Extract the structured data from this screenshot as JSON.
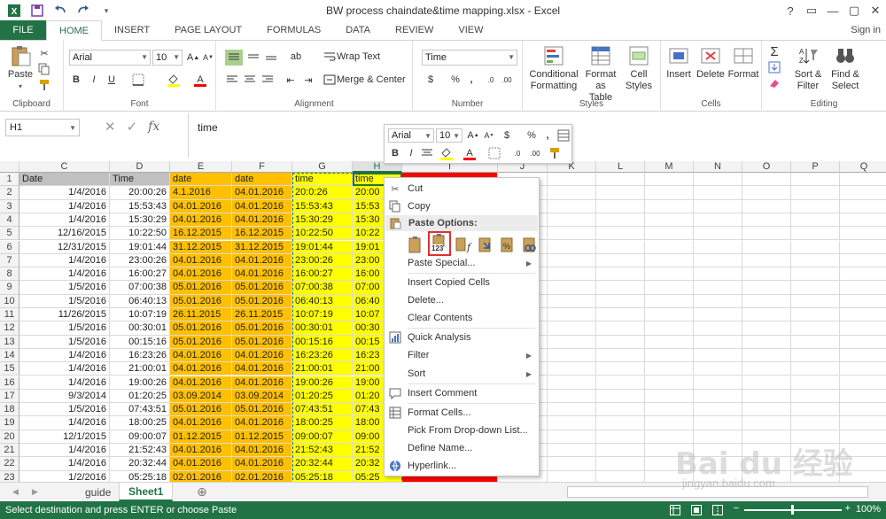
{
  "window": {
    "title": "BW process chaindate&time mapping.xlsx - Excel",
    "controls": [
      "?",
      "▭",
      "—",
      "▢",
      "✕"
    ],
    "signin": "Sign in"
  },
  "ribbon_tabs": [
    "FILE",
    "HOME",
    "INSERT",
    "PAGE LAYOUT",
    "FORMULAS",
    "DATA",
    "REVIEW",
    "VIEW"
  ],
  "ribbon": {
    "clipboard": {
      "paste": "Paste",
      "label": "Clipboard"
    },
    "font": {
      "name": "Arial",
      "size": "10",
      "bold": "B",
      "italic": "I",
      "underline": "U",
      "label": "Font"
    },
    "alignment": {
      "wrap": "Wrap Text",
      "merge": "Merge & Center",
      "label": "Alignment"
    },
    "number": {
      "format": "Time",
      "currency": "$",
      "percent": "%",
      "comma": ",",
      "label": "Number"
    },
    "styles": {
      "conditional": "Conditional\nFormatting",
      "format_table": "Format as\nTable",
      "cell_styles": "Cell\nStyles",
      "label": "Styles"
    },
    "cells": {
      "insert": "Insert",
      "delete": "Delete",
      "format": "Format",
      "label": "Cells"
    },
    "editing": {
      "sort": "Sort &\nFilter",
      "find": "Find &\nSelect",
      "label": "Editing"
    }
  },
  "formula_bar": {
    "name_box": "H1",
    "fx": "fx",
    "content": "time"
  },
  "columns": [
    {
      "letter": "C",
      "w": 102
    },
    {
      "letter": "D",
      "w": 68
    },
    {
      "letter": "E",
      "w": 70
    },
    {
      "letter": "F",
      "w": 68
    },
    {
      "letter": "G",
      "w": 68
    },
    {
      "letter": "H",
      "w": 56
    },
    {
      "letter": "I",
      "w": 108
    },
    {
      "letter": "J",
      "w": 56
    },
    {
      "letter": "K",
      "w": 55
    },
    {
      "letter": "L",
      "w": 55
    },
    {
      "letter": "M",
      "w": 55
    },
    {
      "letter": "N",
      "w": 55
    },
    {
      "letter": "O",
      "w": 55
    },
    {
      "letter": "P",
      "w": 55
    },
    {
      "letter": "Q",
      "w": 55
    }
  ],
  "rows": [
    {
      "n": "1",
      "c": [
        "Date",
        "Time",
        "date",
        "date",
        "time",
        "time",
        "",
        ""
      ]
    },
    {
      "n": "2",
      "c": [
        "1/4/2016",
        "20:00:26",
        "4.1.2016",
        "04.01.2016",
        "20:0:26",
        "20:00",
        "",
        ""
      ]
    },
    {
      "n": "3",
      "c": [
        "1/4/2016",
        "15:53:43",
        "04.01.2016",
        "04.01.2016",
        "15:53:43",
        "15:53",
        "",
        ""
      ]
    },
    {
      "n": "4",
      "c": [
        "1/4/2016",
        "15:30:29",
        "04.01.2016",
        "04.01.2016",
        "15:30:29",
        "15:30",
        "",
        ""
      ]
    },
    {
      "n": "5",
      "c": [
        "12/16/2015",
        "10:22:50",
        "16.12.2015",
        "16.12.2015",
        "10:22:50",
        "10:22",
        "",
        ""
      ]
    },
    {
      "n": "6",
      "c": [
        "12/31/2015",
        "19:01:44",
        "31.12.2015",
        "31.12.2015",
        "19:01:44",
        "19:01",
        "",
        ""
      ]
    },
    {
      "n": "7",
      "c": [
        "1/4/2016",
        "23:00:26",
        "04.01.2016",
        "04.01.2016",
        "23:00:26",
        "23:00",
        "",
        ""
      ]
    },
    {
      "n": "8",
      "c": [
        "1/4/2016",
        "16:00:27",
        "04.01.2016",
        "04.01.2016",
        "16:00:27",
        "16:00",
        "",
        ""
      ]
    },
    {
      "n": "9",
      "c": [
        "1/5/2016",
        "07:00:38",
        "05.01.2016",
        "05.01.2016",
        "07:00:38",
        "07:00",
        "",
        ""
      ]
    },
    {
      "n": "10",
      "c": [
        "1/5/2016",
        "06:40:13",
        "05.01.2016",
        "05.01.2016",
        "06:40:13",
        "06:40",
        "",
        ""
      ]
    },
    {
      "n": "11",
      "c": [
        "11/26/2015",
        "10:07:19",
        "26.11.2015",
        "26.11.2015",
        "10:07:19",
        "10:07",
        "",
        ""
      ]
    },
    {
      "n": "12",
      "c": [
        "1/5/2016",
        "00:30:01",
        "05.01.2016",
        "05.01.2016",
        "00:30:01",
        "00:30",
        "",
        ""
      ]
    },
    {
      "n": "13",
      "c": [
        "1/5/2016",
        "00:15:16",
        "05.01.2016",
        "05.01.2016",
        "00:15:16",
        "00:15",
        "",
        ""
      ]
    },
    {
      "n": "14",
      "c": [
        "1/4/2016",
        "16:23:26",
        "04.01.2016",
        "04.01.2016",
        "16:23:26",
        "16:23",
        "",
        ""
      ]
    },
    {
      "n": "15",
      "c": [
        "1/4/2016",
        "21:00:01",
        "04.01.2016",
        "04.01.2016",
        "21:00:01",
        "21:00",
        "",
        ""
      ]
    },
    {
      "n": "16",
      "c": [
        "1/4/2016",
        "19:00:26",
        "04.01.2016",
        "04.01.2016",
        "19:00:26",
        "19:00",
        "",
        ""
      ]
    },
    {
      "n": "17",
      "c": [
        "9/3/2014",
        "01:20:25",
        "03.09.2014",
        "03.09.2014",
        "01:20:25",
        "01:20",
        "",
        ""
      ]
    },
    {
      "n": "18",
      "c": [
        "1/5/2016",
        "07:43:51",
        "05.01.2016",
        "05.01.2016",
        "07:43:51",
        "07:43",
        "",
        ""
      ]
    },
    {
      "n": "19",
      "c": [
        "1/4/2016",
        "18:00:25",
        "04.01.2016",
        "04.01.2016",
        "18:00:25",
        "18:00",
        "",
        ""
      ]
    },
    {
      "n": "20",
      "c": [
        "12/1/2015",
        "09:00:07",
        "01.12.2015",
        "01.12.2015",
        "09:00:07",
        "09:00",
        "",
        ""
      ]
    },
    {
      "n": "21",
      "c": [
        "1/4/2016",
        "21:52:43",
        "04.01.2016",
        "04.01.2016",
        "21:52:43",
        "21:52",
        "",
        ""
      ]
    },
    {
      "n": "22",
      "c": [
        "1/4/2016",
        "20:32:44",
        "04.01.2016",
        "04.01.2016",
        "20:32:44",
        "20:32",
        "",
        ""
      ]
    },
    {
      "n": "23",
      "c": [
        "1/2/2016",
        "05:25:18",
        "02.01.2016",
        "02.01.2016",
        "05:25:18",
        "05:25",
        "",
        ""
      ]
    }
  ],
  "context_menu": {
    "cut": "Cut",
    "copy": "Copy",
    "paste_options": "Paste Options:",
    "paste_values_badge": "123",
    "paste_special": "Paste Special...",
    "insert_copied": "Insert Copied Cells",
    "delete": "Delete...",
    "clear": "Clear Contents",
    "quick_analysis": "Quick Analysis",
    "filter": "Filter",
    "sort": "Sort",
    "insert_comment": "Insert Comment",
    "format_cells": "Format Cells...",
    "pick_list": "Pick From Drop-down List...",
    "define_name": "Define Name...",
    "hyperlink": "Hyperlink..."
  },
  "mini_toolbar": {
    "font": "Arial",
    "size": "10",
    "currency": "$",
    "percent": "%",
    "comma": ",",
    "bold": "B",
    "italic": "I"
  },
  "sheets": [
    "guide",
    "Sheet1"
  ],
  "status": {
    "message": "Select destination and press ENTER or choose Paste",
    "zoom": "100%"
  },
  "watermark": {
    "main": "Bai du 经验",
    "sub": "jingyan.baidu.com"
  },
  "colors": {
    "excel_green": "#217346",
    "orange": "#ffc000",
    "yellow": "#ffff00",
    "red": "#ff0000",
    "header_grey": "#c0c0c0"
  }
}
